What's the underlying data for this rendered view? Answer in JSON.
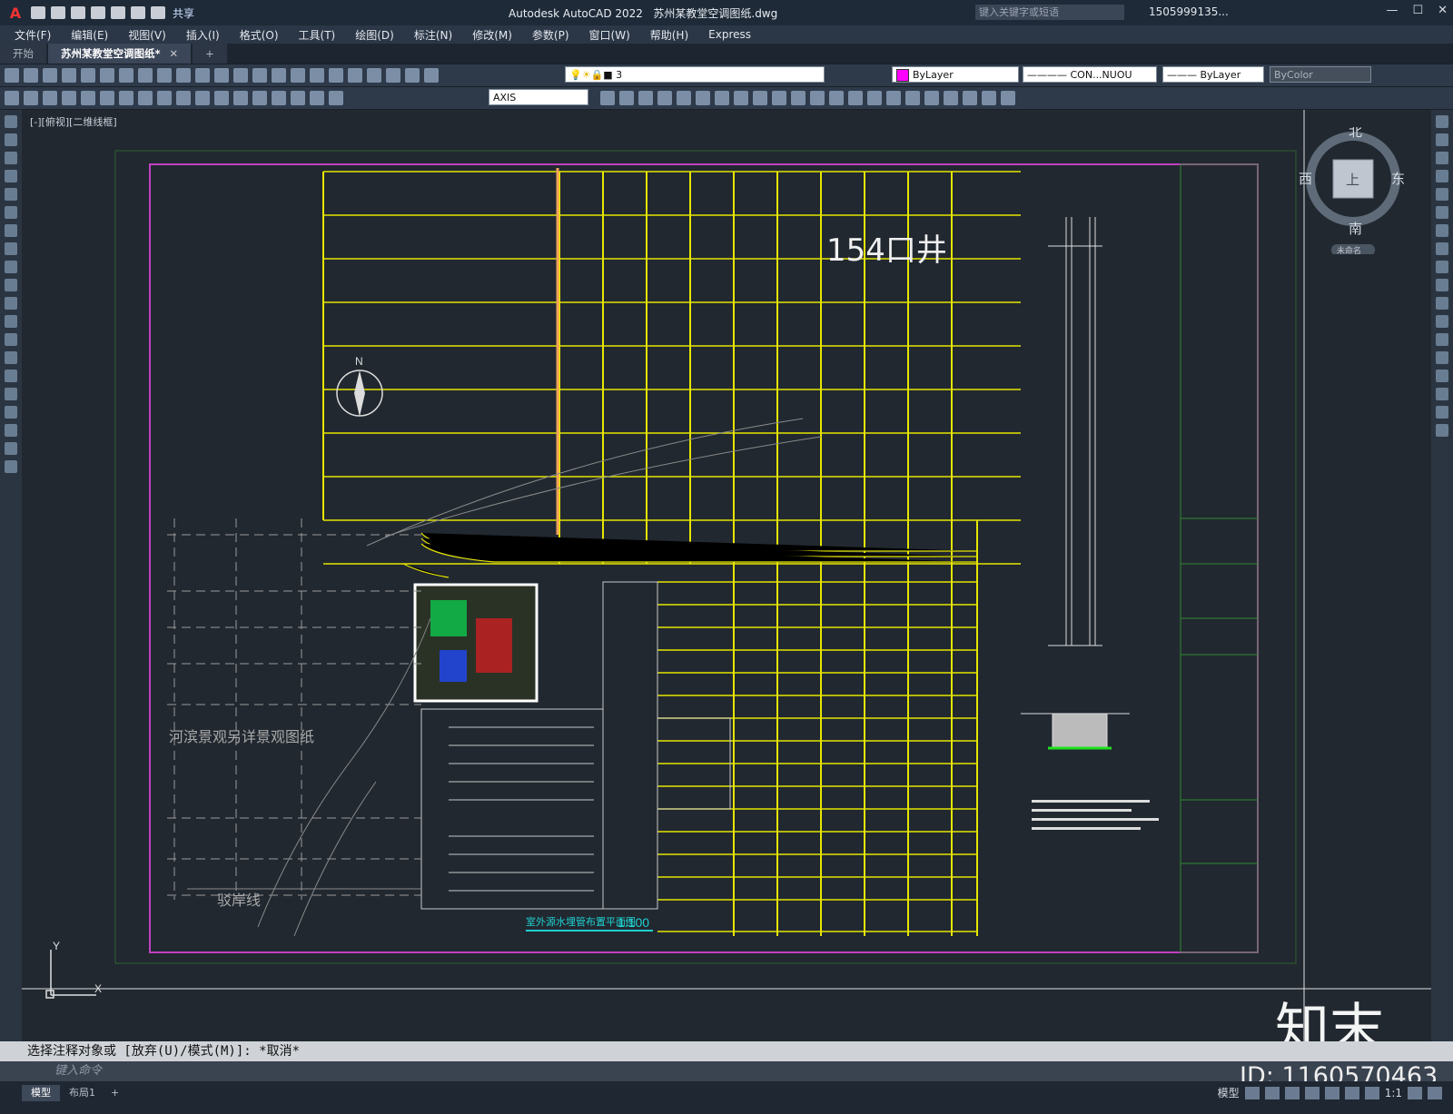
{
  "app": {
    "title": "Autodesk AutoCAD 2022",
    "file": "苏州某教堂空调图纸.dwg",
    "share_label": "共享",
    "search_placeholder": "键入关键字或短语",
    "user": "1505999135..."
  },
  "menu": [
    "文件(F)",
    "编辑(E)",
    "视图(V)",
    "插入(I)",
    "格式(O)",
    "工具(T)",
    "绘图(D)",
    "标注(N)",
    "修改(M)",
    "参数(P)",
    "窗口(W)",
    "帮助(H)",
    "Express"
  ],
  "tabs": [
    {
      "label": "开始"
    },
    {
      "label": "苏州某教堂空调图纸*"
    }
  ],
  "properties": {
    "layer": "3",
    "color": "ByLayer",
    "linetype": "CON...NUOU",
    "lineweight": "ByLayer",
    "plotstyle": "ByColor",
    "dimstyle": "AXIS",
    "color_swatch": "#ff00ff"
  },
  "viewport": {
    "label": "[-][俯视][二维线框]"
  },
  "drawing": {
    "big_label": "154口井",
    "plan_title": "室外源水埋管布置平面图",
    "scale": "1:100",
    "landscape_note": "河滨景观另详景观图纸",
    "shoreline": "驳岸线",
    "north": "N"
  },
  "compass": {
    "north": "北",
    "south": "南",
    "east": "东",
    "west": "西",
    "center": "上",
    "wcs": "未命名"
  },
  "command": {
    "history": "选择注释对象或 [放弃(U)/模式(M)]: *取消*",
    "placeholder": "键入命令"
  },
  "layout_tabs": [
    "模型",
    "布局1"
  ],
  "status": {
    "model": "模型",
    "scale": "1:1"
  },
  "watermark": {
    "brand": "知末",
    "id": "ID: 1160570463"
  }
}
